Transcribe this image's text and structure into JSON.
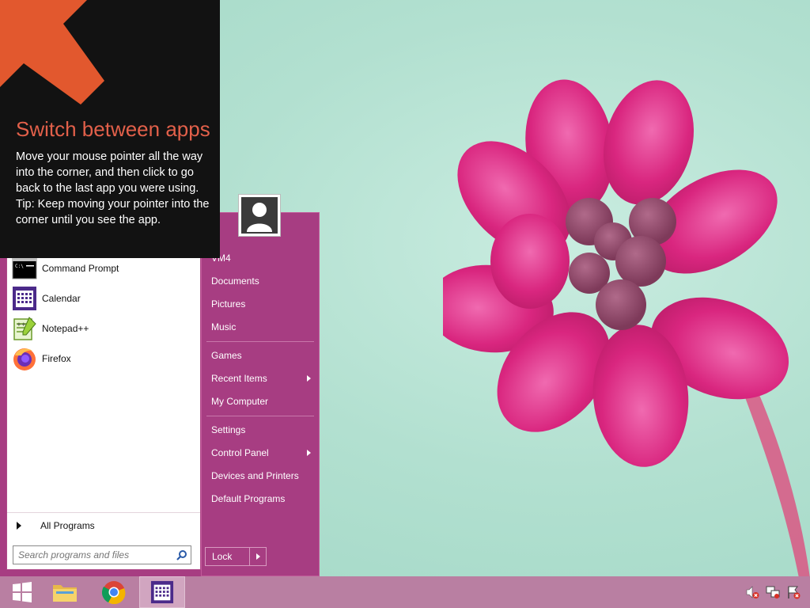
{
  "tip": {
    "title": "Switch between apps",
    "body": "Move your mouse pointer all the way into the corner, and then click to go back to the last app you were using.",
    "tip_text": "Tip: Keep moving your pointer into the corner until you see the app.",
    "accent_color": "#e2604a"
  },
  "start_menu": {
    "programs": [
      {
        "label": "Command Prompt",
        "icon": "command-prompt-icon"
      },
      {
        "label": "Calendar",
        "icon": "calendar-icon"
      },
      {
        "label": "Notepad++",
        "icon": "notepad-plus-plus-icon"
      },
      {
        "label": "Firefox",
        "icon": "firefox-icon"
      }
    ],
    "all_programs_label": "All Programs",
    "search_placeholder": "Search programs and files",
    "right_items": [
      {
        "label": "VM4"
      },
      {
        "label": "Documents"
      },
      {
        "label": "Pictures"
      },
      {
        "label": "Music"
      },
      {
        "label": "Games"
      },
      {
        "label": "Recent Items",
        "submenu": true
      },
      {
        "label": "My Computer"
      },
      {
        "label": "Settings"
      },
      {
        "label": "Control Panel",
        "submenu": true
      },
      {
        "label": "Devices and Printers"
      },
      {
        "label": "Default Programs"
      }
    ],
    "lock_label": "Lock",
    "accent_color": "#a73d82"
  },
  "taskbar": {
    "buttons": [
      {
        "icon": "windows-logo-icon"
      },
      {
        "icon": "file-explorer-icon"
      },
      {
        "icon": "chrome-icon"
      },
      {
        "icon": "calendar-icon",
        "active": true
      }
    ],
    "tray_icons": [
      "volume-muted-icon",
      "network-icon",
      "action-center-icon"
    ],
    "color": "#b97fa2"
  }
}
